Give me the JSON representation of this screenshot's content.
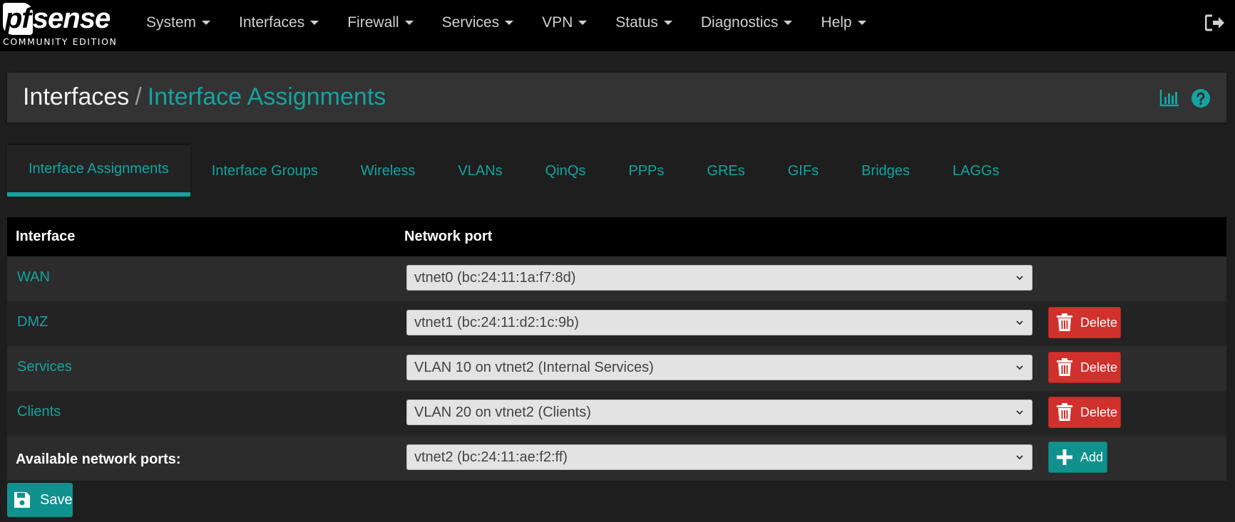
{
  "brand": {
    "logo_text_a": "pf",
    "logo_text_b": "sense",
    "subtitle": "COMMUNITY EDITION"
  },
  "nav": {
    "items": [
      {
        "label": "System"
      },
      {
        "label": "Interfaces"
      },
      {
        "label": "Firewall"
      },
      {
        "label": "Services"
      },
      {
        "label": "VPN"
      },
      {
        "label": "Status"
      },
      {
        "label": "Diagnostics"
      },
      {
        "label": "Help"
      }
    ],
    "logout_icon": "sign-out-icon"
  },
  "breadcrumb": {
    "root": "Interfaces",
    "separator": "/",
    "current": "Interface Assignments",
    "icons": [
      "chart-icon",
      "help-icon"
    ]
  },
  "tabs": [
    {
      "label": "Interface Assignments",
      "active": true
    },
    {
      "label": "Interface Groups"
    },
    {
      "label": "Wireless"
    },
    {
      "label": "VLANs"
    },
    {
      "label": "QinQs"
    },
    {
      "label": "PPPs"
    },
    {
      "label": "GREs"
    },
    {
      "label": "GIFs"
    },
    {
      "label": "Bridges"
    },
    {
      "label": "LAGGs"
    }
  ],
  "table": {
    "headers": {
      "interface": "Interface",
      "network_port": "Network port"
    },
    "rows": [
      {
        "interface": "WAN",
        "port": "vtnet0 (bc:24:11:1a:f7:8d)",
        "delete": false
      },
      {
        "interface": "DMZ",
        "port": "vtnet1 (bc:24:11:d2:1c:9b)",
        "delete": true,
        "delete_label": "Delete"
      },
      {
        "interface": "Services",
        "port": "VLAN 10 on vtnet2 (Internal Services)",
        "delete": true,
        "delete_label": "Delete"
      },
      {
        "interface": "Clients",
        "port": "VLAN 20 on vtnet2 (Clients)",
        "delete": true,
        "delete_label": "Delete"
      }
    ],
    "available": {
      "label": "Available network ports:",
      "port": "vtnet2 (bc:24:11:ae:f2:ff)",
      "add_label": "Add"
    }
  },
  "save_label": "Save",
  "colors": {
    "accent": "#14a3a0",
    "danger": "#d0312d",
    "navbar": "#000000",
    "background": "#1e1e1e"
  }
}
